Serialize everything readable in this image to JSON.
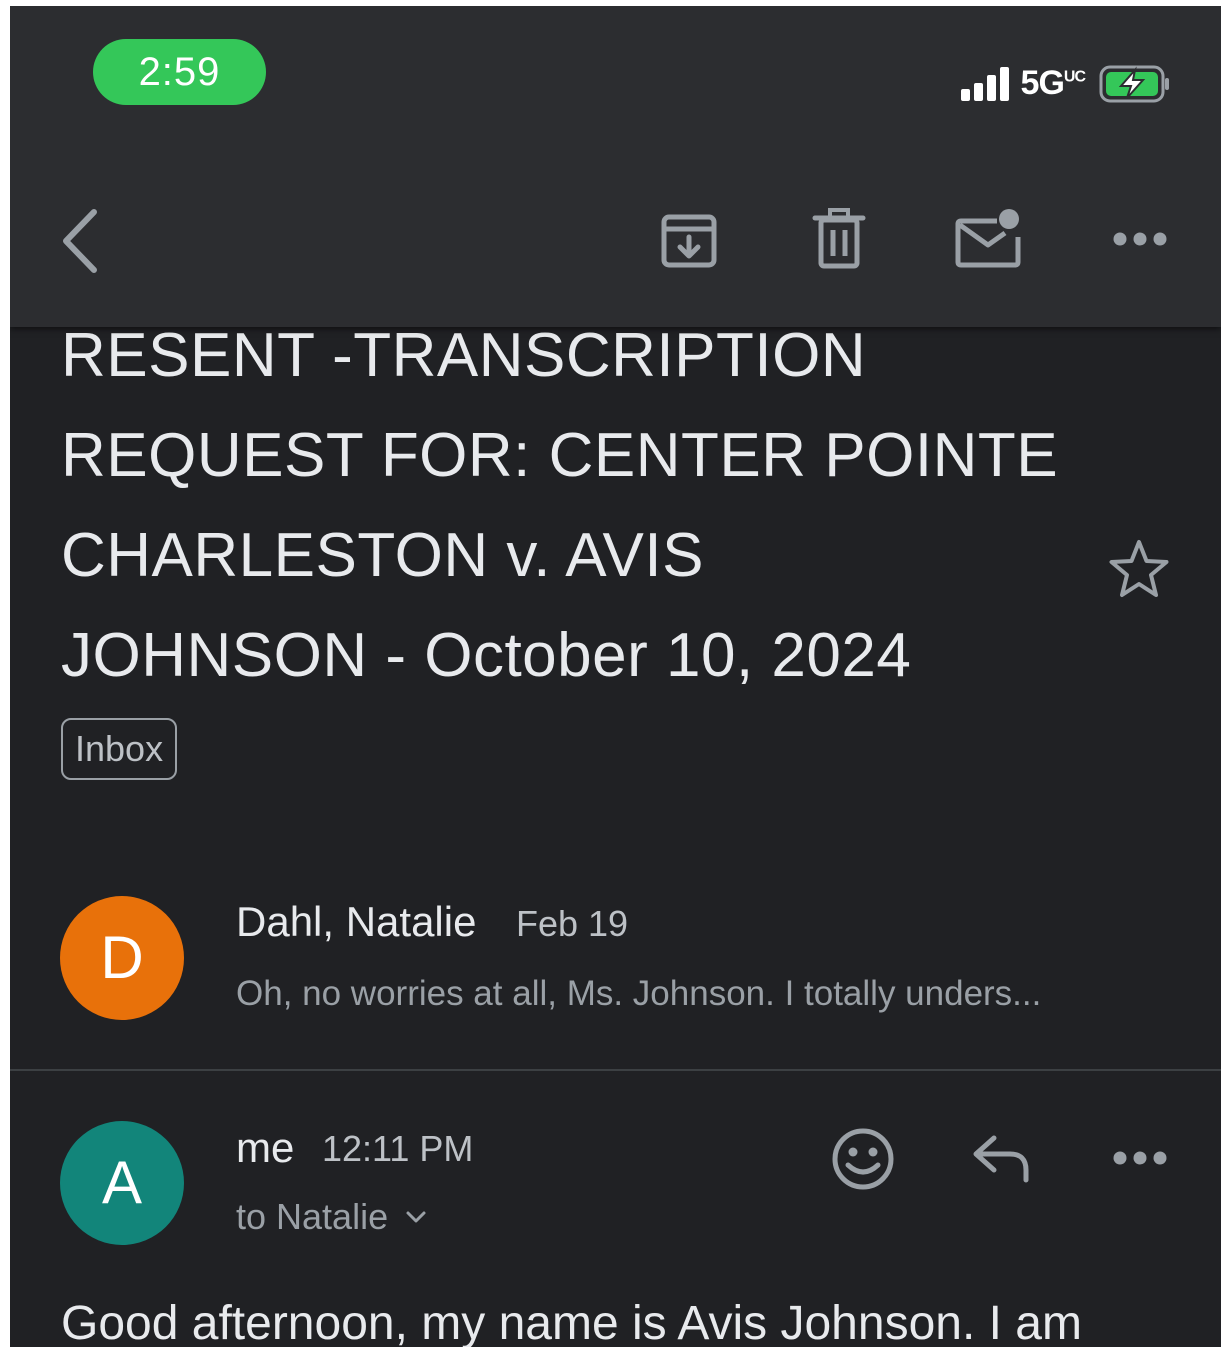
{
  "status_bar": {
    "time": "2:59",
    "network": "5G",
    "network_sup": "UC"
  },
  "toolbar": {
    "back_icon": "chevron-left-icon",
    "archive_icon": "archive-icon",
    "delete_icon": "trash-icon",
    "mark_unread_icon": "mail-unread-icon",
    "more_icon": "more-horizontal-icon"
  },
  "email": {
    "subject_lines": [
      "RESENT -TRANSCRIPTION",
      "REQUEST FOR: CENTER POINTE",
      "CHARLESTON v. AVIS",
      "JOHNSON - October 10, 2024"
    ],
    "label": "Inbox",
    "star_icon": "star-outline-icon"
  },
  "messages": [
    {
      "avatar_letter": "D",
      "avatar_color": "#e8710a",
      "sender": "Dahl, Natalie",
      "date": "Feb 19",
      "snippet": "Oh, no worries at all, Ms. Johnson. I totally unders..."
    },
    {
      "avatar_letter": "A",
      "avatar_color": "#12857a",
      "sender": "me",
      "date": "12:11 PM",
      "recipient": "to Natalie",
      "body_first_line": "Good afternoon, my name is Avis Johnson. I am"
    }
  ],
  "colors": {
    "background": "#202124",
    "toolbar": "#2c2d30",
    "text_primary": "#e8eaed",
    "text_secondary": "#9aa0a6",
    "time_pill": "#34c759"
  }
}
